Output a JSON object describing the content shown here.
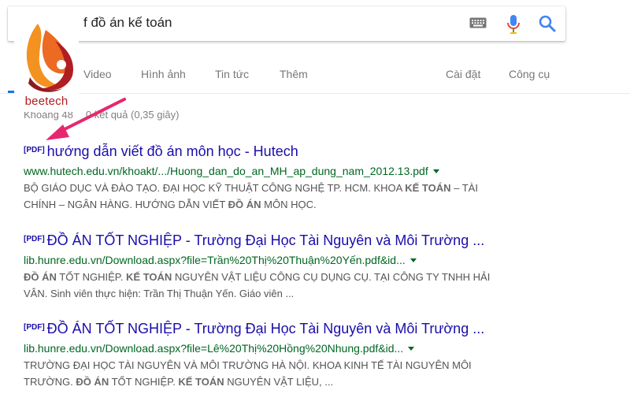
{
  "search": {
    "query": "f đồ án kế toán",
    "keyboard_icon": "keyboard-icon",
    "mic_icon": "microphone-icon",
    "search_icon": "search-icon"
  },
  "tabs": {
    "video": "Video",
    "images": "Hình ảnh",
    "news": "Tin tức",
    "more": "Thêm",
    "settings": "Cài đặt",
    "tools": "Công cụ"
  },
  "stats": {
    "text_start": "Khoảng 48",
    "text_end": "0 kết quả (0,35 giây)"
  },
  "logo": {
    "text": "beetech"
  },
  "results": [
    {
      "tag": "[PDF]",
      "title": "hướng dẫn viết đồ án môn học - Hutech",
      "url": "www.hutech.edu.vn/khoakt/.../Huong_dan_do_an_MH_ap_dung_nam_2012.13.pdf",
      "snippet_1": "BỘ GIÁO DỤC VÀ ĐÀO TẠO. ĐẠI HỌC KỸ THUẬT CÔNG NGHỆ TP. HCM. KHOA ",
      "snippet_1_bold": "KẾ TOÁN",
      "snippet_1_tail": " – TÀI",
      "snippet_2": "CHÍNH – NGÂN HÀNG. HƯỚNG DẪN VIẾT ",
      "snippet_2_bold": "ĐỒ ÁN",
      "snippet_2_tail": " MÔN HỌC."
    },
    {
      "tag": "[PDF]",
      "title": "ĐỒ ÁN TỐT NGHIỆP - Trường Đại Học Tài Nguyên và Môi Trường ...",
      "url": "lib.hunre.edu.vn/Download.aspx?file=Trần%20Thị%20Thuận%20Yến.pdf&id...",
      "snippet_1_bold": "ĐỒ ÁN",
      "snippet_1": " TỐT NGHIỆP. ",
      "snippet_1_bold2": "KẾ TOÁN",
      "snippet_1_tail": " NGUYÊN VẬT LIỆU CÔNG CỤ DỤNG CỤ. TẠI CÔNG TY TNHH HẢI",
      "snippet_2": "VÂN. Sinh viên thực hiện: Trần Thị Thuận Yến. Giáo viên ..."
    },
    {
      "tag": "[PDF]",
      "title": "ĐỒ ÁN TỐT NGHIỆP - Trường Đại Học Tài Nguyên và Môi Trường ...",
      "url": "lib.hunre.edu.vn/Download.aspx?file=Lê%20Thị%20Hồng%20Nhung.pdf&id...",
      "snippet_1": "TRƯỜNG ĐẠI HỌC TÀI NGUYÊN VÀ MÔI TRƯỜNG HÀ NỘI. KHOA KINH TẾ TÀI NGUYÊN MÔI",
      "snippet_2": "TRƯỜNG. ",
      "snippet_2_bold": "ĐỒ ÁN",
      "snippet_2_mid": " TỐT NGHIỆP. ",
      "snippet_2_bold2": "KẾ TOÁN",
      "snippet_2_tail": " NGUYÊN VẬT LIỆU, ..."
    }
  ],
  "colors": {
    "link": "#1a0dab",
    "url": "#006621",
    "annotation_arrow": "#e8266e",
    "logo_red": "#b01e23",
    "logo_orange": "#f39121"
  }
}
